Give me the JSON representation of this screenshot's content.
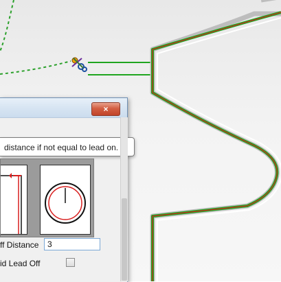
{
  "tooltip": {
    "text": "distance if not equal to lead on."
  },
  "dialog": {
    "close_label": "×",
    "fields": {
      "lead_off_distance_label": "ff Distance",
      "lead_off_distance_value": "3",
      "avoid_lead_off_label": "id Lead Off",
      "avoid_lead_off_checked": false
    }
  },
  "colors": {
    "path_green": "#1fa51f",
    "path_red": "#d81e1e",
    "dotted_green": "#2aa02a",
    "dialog_close": "#c9472c"
  },
  "icons": {
    "tool": "scissors-tool-icon",
    "clock": "clock-icon"
  }
}
